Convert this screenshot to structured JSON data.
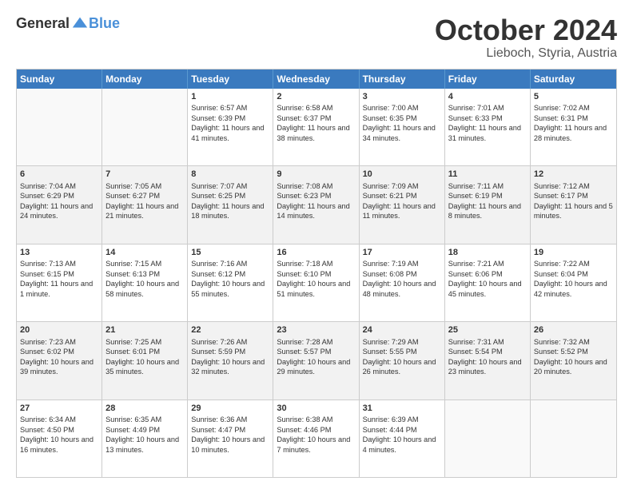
{
  "header": {
    "logo_general": "General",
    "logo_blue": "Blue",
    "month_title": "October 2024",
    "location": "Lieboch, Styria, Austria"
  },
  "weekdays": [
    "Sunday",
    "Monday",
    "Tuesday",
    "Wednesday",
    "Thursday",
    "Friday",
    "Saturday"
  ],
  "weeks": [
    [
      {
        "day": "",
        "sunrise": "",
        "sunset": "",
        "daylight": "",
        "empty": true
      },
      {
        "day": "",
        "sunrise": "",
        "sunset": "",
        "daylight": "",
        "empty": true
      },
      {
        "day": "1",
        "sunrise": "Sunrise: 6:57 AM",
        "sunset": "Sunset: 6:39 PM",
        "daylight": "Daylight: 11 hours and 41 minutes.",
        "empty": false
      },
      {
        "day": "2",
        "sunrise": "Sunrise: 6:58 AM",
        "sunset": "Sunset: 6:37 PM",
        "daylight": "Daylight: 11 hours and 38 minutes.",
        "empty": false
      },
      {
        "day": "3",
        "sunrise": "Sunrise: 7:00 AM",
        "sunset": "Sunset: 6:35 PM",
        "daylight": "Daylight: 11 hours and 34 minutes.",
        "empty": false
      },
      {
        "day": "4",
        "sunrise": "Sunrise: 7:01 AM",
        "sunset": "Sunset: 6:33 PM",
        "daylight": "Daylight: 11 hours and 31 minutes.",
        "empty": false
      },
      {
        "day": "5",
        "sunrise": "Sunrise: 7:02 AM",
        "sunset": "Sunset: 6:31 PM",
        "daylight": "Daylight: 11 hours and 28 minutes.",
        "empty": false
      }
    ],
    [
      {
        "day": "6",
        "sunrise": "Sunrise: 7:04 AM",
        "sunset": "Sunset: 6:29 PM",
        "daylight": "Daylight: 11 hours and 24 minutes.",
        "empty": false
      },
      {
        "day": "7",
        "sunrise": "Sunrise: 7:05 AM",
        "sunset": "Sunset: 6:27 PM",
        "daylight": "Daylight: 11 hours and 21 minutes.",
        "empty": false
      },
      {
        "day": "8",
        "sunrise": "Sunrise: 7:07 AM",
        "sunset": "Sunset: 6:25 PM",
        "daylight": "Daylight: 11 hours and 18 minutes.",
        "empty": false
      },
      {
        "day": "9",
        "sunrise": "Sunrise: 7:08 AM",
        "sunset": "Sunset: 6:23 PM",
        "daylight": "Daylight: 11 hours and 14 minutes.",
        "empty": false
      },
      {
        "day": "10",
        "sunrise": "Sunrise: 7:09 AM",
        "sunset": "Sunset: 6:21 PM",
        "daylight": "Daylight: 11 hours and 11 minutes.",
        "empty": false
      },
      {
        "day": "11",
        "sunrise": "Sunrise: 7:11 AM",
        "sunset": "Sunset: 6:19 PM",
        "daylight": "Daylight: 11 hours and 8 minutes.",
        "empty": false
      },
      {
        "day": "12",
        "sunrise": "Sunrise: 7:12 AM",
        "sunset": "Sunset: 6:17 PM",
        "daylight": "Daylight: 11 hours and 5 minutes.",
        "empty": false
      }
    ],
    [
      {
        "day": "13",
        "sunrise": "Sunrise: 7:13 AM",
        "sunset": "Sunset: 6:15 PM",
        "daylight": "Daylight: 11 hours and 1 minute.",
        "empty": false
      },
      {
        "day": "14",
        "sunrise": "Sunrise: 7:15 AM",
        "sunset": "Sunset: 6:13 PM",
        "daylight": "Daylight: 10 hours and 58 minutes.",
        "empty": false
      },
      {
        "day": "15",
        "sunrise": "Sunrise: 7:16 AM",
        "sunset": "Sunset: 6:12 PM",
        "daylight": "Daylight: 10 hours and 55 minutes.",
        "empty": false
      },
      {
        "day": "16",
        "sunrise": "Sunrise: 7:18 AM",
        "sunset": "Sunset: 6:10 PM",
        "daylight": "Daylight: 10 hours and 51 minutes.",
        "empty": false
      },
      {
        "day": "17",
        "sunrise": "Sunrise: 7:19 AM",
        "sunset": "Sunset: 6:08 PM",
        "daylight": "Daylight: 10 hours and 48 minutes.",
        "empty": false
      },
      {
        "day": "18",
        "sunrise": "Sunrise: 7:21 AM",
        "sunset": "Sunset: 6:06 PM",
        "daylight": "Daylight: 10 hours and 45 minutes.",
        "empty": false
      },
      {
        "day": "19",
        "sunrise": "Sunrise: 7:22 AM",
        "sunset": "Sunset: 6:04 PM",
        "daylight": "Daylight: 10 hours and 42 minutes.",
        "empty": false
      }
    ],
    [
      {
        "day": "20",
        "sunrise": "Sunrise: 7:23 AM",
        "sunset": "Sunset: 6:02 PM",
        "daylight": "Daylight: 10 hours and 39 minutes.",
        "empty": false
      },
      {
        "day": "21",
        "sunrise": "Sunrise: 7:25 AM",
        "sunset": "Sunset: 6:01 PM",
        "daylight": "Daylight: 10 hours and 35 minutes.",
        "empty": false
      },
      {
        "day": "22",
        "sunrise": "Sunrise: 7:26 AM",
        "sunset": "Sunset: 5:59 PM",
        "daylight": "Daylight: 10 hours and 32 minutes.",
        "empty": false
      },
      {
        "day": "23",
        "sunrise": "Sunrise: 7:28 AM",
        "sunset": "Sunset: 5:57 PM",
        "daylight": "Daylight: 10 hours and 29 minutes.",
        "empty": false
      },
      {
        "day": "24",
        "sunrise": "Sunrise: 7:29 AM",
        "sunset": "Sunset: 5:55 PM",
        "daylight": "Daylight: 10 hours and 26 minutes.",
        "empty": false
      },
      {
        "day": "25",
        "sunrise": "Sunrise: 7:31 AM",
        "sunset": "Sunset: 5:54 PM",
        "daylight": "Daylight: 10 hours and 23 minutes.",
        "empty": false
      },
      {
        "day": "26",
        "sunrise": "Sunrise: 7:32 AM",
        "sunset": "Sunset: 5:52 PM",
        "daylight": "Daylight: 10 hours and 20 minutes.",
        "empty": false
      }
    ],
    [
      {
        "day": "27",
        "sunrise": "Sunrise: 6:34 AM",
        "sunset": "Sunset: 4:50 PM",
        "daylight": "Daylight: 10 hours and 16 minutes.",
        "empty": false
      },
      {
        "day": "28",
        "sunrise": "Sunrise: 6:35 AM",
        "sunset": "Sunset: 4:49 PM",
        "daylight": "Daylight: 10 hours and 13 minutes.",
        "empty": false
      },
      {
        "day": "29",
        "sunrise": "Sunrise: 6:36 AM",
        "sunset": "Sunset: 4:47 PM",
        "daylight": "Daylight: 10 hours and 10 minutes.",
        "empty": false
      },
      {
        "day": "30",
        "sunrise": "Sunrise: 6:38 AM",
        "sunset": "Sunset: 4:46 PM",
        "daylight": "Daylight: 10 hours and 7 minutes.",
        "empty": false
      },
      {
        "day": "31",
        "sunrise": "Sunrise: 6:39 AM",
        "sunset": "Sunset: 4:44 PM",
        "daylight": "Daylight: 10 hours and 4 minutes.",
        "empty": false
      },
      {
        "day": "",
        "sunrise": "",
        "sunset": "",
        "daylight": "",
        "empty": true
      },
      {
        "day": "",
        "sunrise": "",
        "sunset": "",
        "daylight": "",
        "empty": true
      }
    ]
  ]
}
